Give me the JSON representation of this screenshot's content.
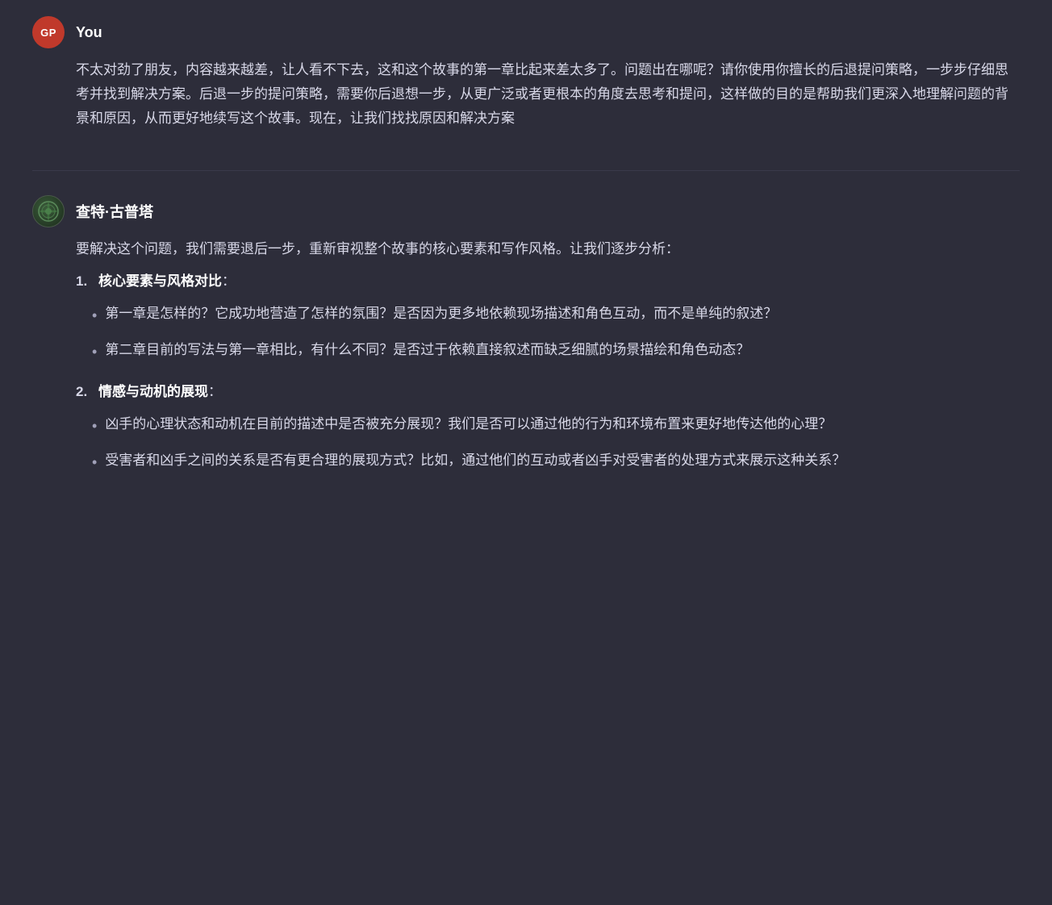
{
  "colors": {
    "background": "#2d2d3a",
    "text_primary": "#d8d8e8",
    "text_white": "#ffffff",
    "avatar_user_bg": "#c0392b",
    "divider": "#3a3a4a"
  },
  "user_message": {
    "username": "You",
    "avatar_initials": "GP",
    "content": "不太对劲了朋友，内容越来越差，让人看不下去，这和这个故事的第一章比起来差太多了。问题出在哪呢？请你使用你擅长的后退提问策略，一步步仔细思考并找到解决方案。后退一步的提问策略，需要你后退想一步，从更广泛或者更根本的角度去思考和提问，这样做的目的是帮助我们更深入地理解问题的背景和原因，从而更好地续写这个故事。现在，让我们找找原因和解决方案"
  },
  "bot_message": {
    "username": "查特·古普塔",
    "intro": "要解决这个问题，我们需要退后一步，重新审视整个故事的核心要素和写作风格。让我们逐步分析：",
    "numbered_items": [
      {
        "number": "1.",
        "title": "核心要素与风格对比",
        "colon": "：",
        "bullets": [
          "第一章是怎样的？它成功地营造了怎样的氛围？是否因为更多地依赖现场描述和角色互动，而不是单纯的叙述？",
          "第二章目前的写法与第一章相比，有什么不同？是否过于依赖直接叙述而缺乏细腻的场景描绘和角色动态？"
        ]
      },
      {
        "number": "2.",
        "title": "情感与动机的展现",
        "colon": "：",
        "bullets": [
          "凶手的心理状态和动机在目前的描述中是否被充分展现？我们是否可以通过他的行为和环境布置来更好地传达他的心理？",
          "受害者和凶手之间的关系是否有更合理的展现方式？比如，通过他们的互动或者凶手对受害者的处理方式来展示这种关系？"
        ]
      }
    ]
  }
}
